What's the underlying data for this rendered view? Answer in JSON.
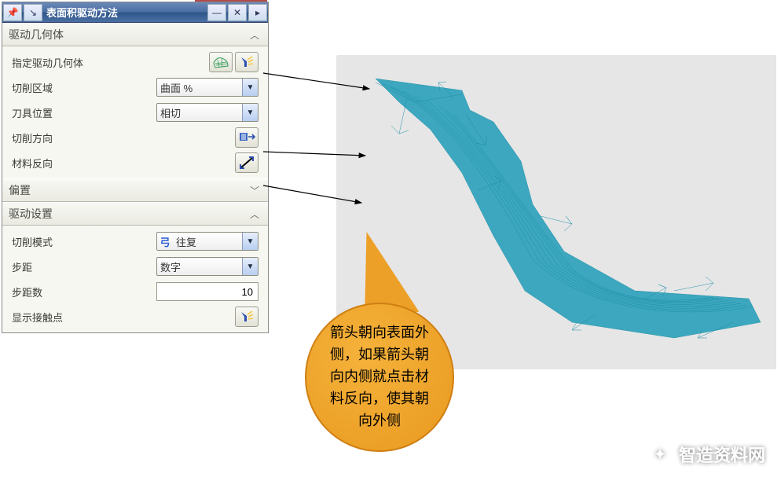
{
  "titlebar": {
    "title": "表面积驱动方法"
  },
  "sections": {
    "drive_geom": {
      "title": "驱动几何体"
    },
    "offset": {
      "title": "偏置"
    },
    "drive_set": {
      "title": "驱动设置"
    }
  },
  "rows": {
    "specify_geom": "指定驱动几何体",
    "cut_region": {
      "label": "切削区域",
      "value": "曲面 %"
    },
    "tool_pos": {
      "label": "刀具位置",
      "value": "相切"
    },
    "cut_dir": "切削方向",
    "mat_rev": "材料反向",
    "cut_mode": {
      "label": "切削模式",
      "value": "往复"
    },
    "step": {
      "label": "步距",
      "value": "数字"
    },
    "step_count": {
      "label": "步距数",
      "value": "10"
    },
    "show_contact": "显示接触点"
  },
  "callout": {
    "text": "箭头朝向表面外侧，如果箭头朝向内侧就点击材料反向，使其朝向外侧"
  },
  "watermark": "智造资料网"
}
